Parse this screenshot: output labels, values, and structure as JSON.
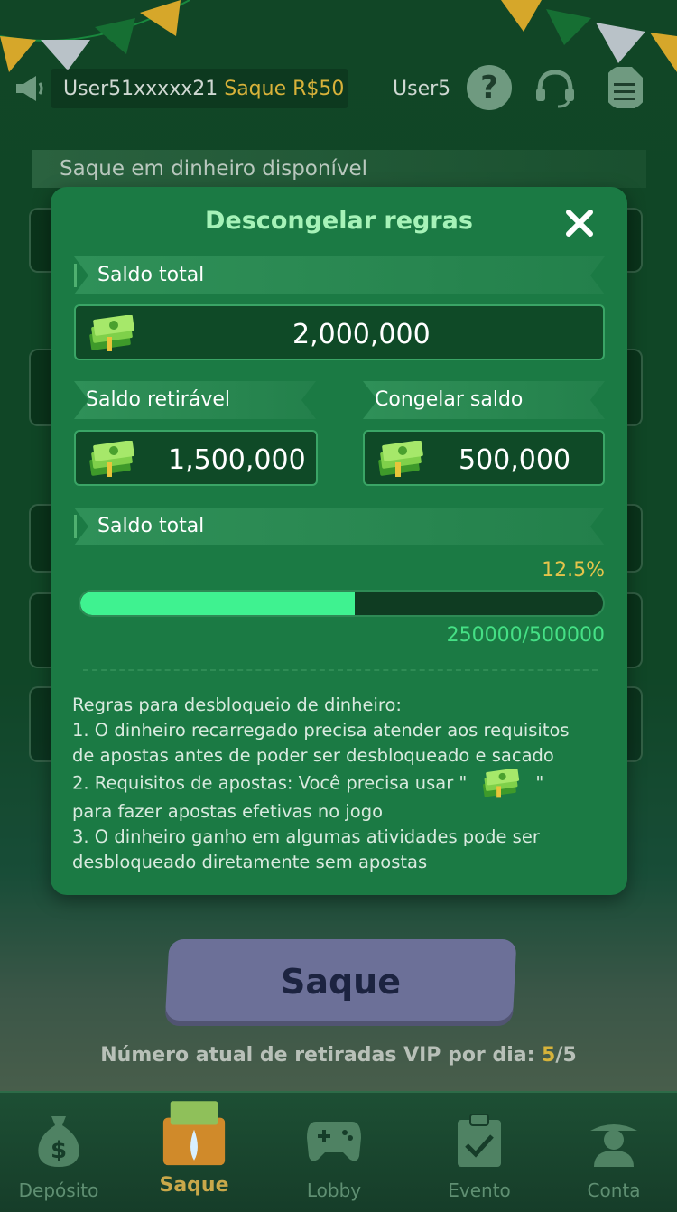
{
  "ticker": {
    "user1": "User51xxxxx21",
    "highlight": "Saque R$50",
    "user2": "User5"
  },
  "header_icons": [
    "announcement-icon",
    "help-icon",
    "headset-icon",
    "document-icon"
  ],
  "background": {
    "section_label": "Saque em dinheiro disponível",
    "withdraw_button": "Saque",
    "vip_prefix": "Número atual de retiradas VIP por dia: ",
    "vip_current": "5",
    "vip_sep": "/",
    "vip_total": "5"
  },
  "modal": {
    "title": "Descongelar regras",
    "total_label": "Saldo total",
    "total_value": "2,000,000",
    "withdrawable_label": "Saldo retirável",
    "withdrawable_value": "1,500,000",
    "frozen_label": "Congelar saldo",
    "frozen_value": "500,000",
    "progress_label": "Saldo total",
    "progress_percent": "12.5%",
    "progress_fraction": 0.525,
    "progress_text": "250000/500000",
    "rules": [
      "Regras para desbloqueio de dinheiro:",
      "1. O dinheiro recarregado precisa atender aos requisitos",
      "de apostas antes de poder ser desbloqueado e sacado",
      "2. Requisitos de apostas: Você precisa usar \"",
      "\"",
      "para fazer apostas efetivas no jogo",
      "3. O dinheiro ganho em algumas atividades pode ser",
      "desbloqueado diretamente sem apostas"
    ]
  },
  "nav": {
    "items": [
      {
        "label": "Depósito",
        "icon": "money-bag-icon"
      },
      {
        "label": "Saque",
        "icon": "withdraw-chest-icon",
        "active": true
      },
      {
        "label": "Lobby",
        "icon": "gamepad-icon"
      },
      {
        "label": "Evento",
        "icon": "clipboard-check-icon"
      },
      {
        "label": "Conta",
        "icon": "person-hat-icon"
      }
    ]
  },
  "colors": {
    "modal_bg": "#1b7a44",
    "accent_green": "#3ff290",
    "accent_gold": "#e4c44b",
    "title_green": "#a6f2b8"
  }
}
